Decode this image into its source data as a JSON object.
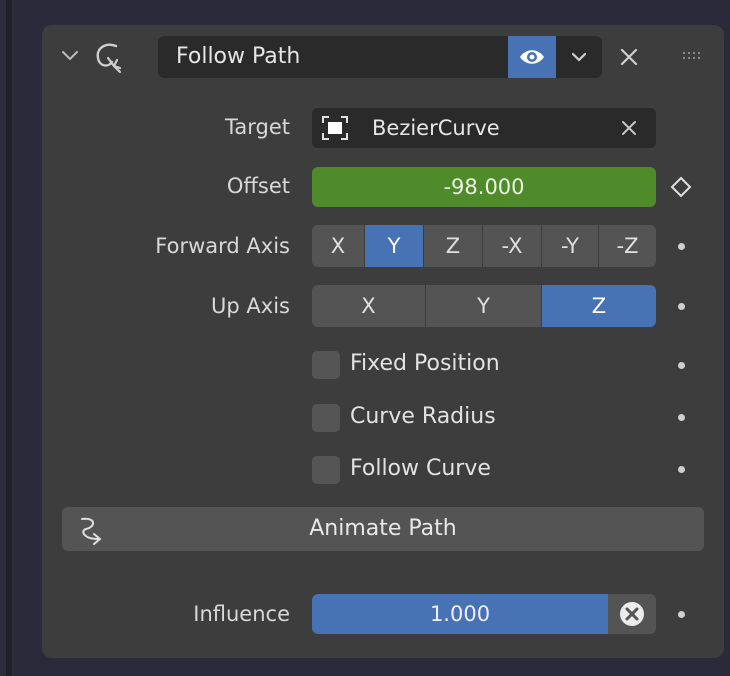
{
  "constraint": {
    "name": "Follow Path",
    "icons": {
      "collapse": "chevron-down-icon",
      "constraint_type": "follow-path-constraint-icon",
      "visibility": "eye-icon",
      "dropdown": "chevron-down-icon",
      "delete": "close-icon",
      "drag": "drag-handle-icon"
    },
    "accent_color": "#4772b3",
    "offset_color": "#4f8a2b"
  },
  "target": {
    "label": "Target",
    "value": "BezierCurve",
    "icon": "curve-object-icon",
    "clear_icon": "close-icon"
  },
  "offset": {
    "label": "Offset",
    "value": "-98.000",
    "keyframe_icon": "keyframe-diamond-icon"
  },
  "forward_axis": {
    "label": "Forward Axis",
    "options": [
      "X",
      "Y",
      "Z",
      "-X",
      "-Y",
      "-Z"
    ],
    "selected": "Y"
  },
  "up_axis": {
    "label": "Up Axis",
    "options": [
      "X",
      "Y",
      "Z"
    ],
    "selected": "Z"
  },
  "checkboxes": {
    "fixed_position": {
      "label": "Fixed Position",
      "checked": false
    },
    "curve_radius": {
      "label": "Curve Radius",
      "checked": false
    },
    "follow_curve": {
      "label": "Follow Curve",
      "checked": false
    }
  },
  "animate_path": {
    "label": "Animate Path",
    "icon": "animate-path-icon"
  },
  "influence": {
    "label": "Influence",
    "value": "1.000",
    "fraction": 1.0,
    "disable_icon": "disable-keep-transform-icon"
  }
}
